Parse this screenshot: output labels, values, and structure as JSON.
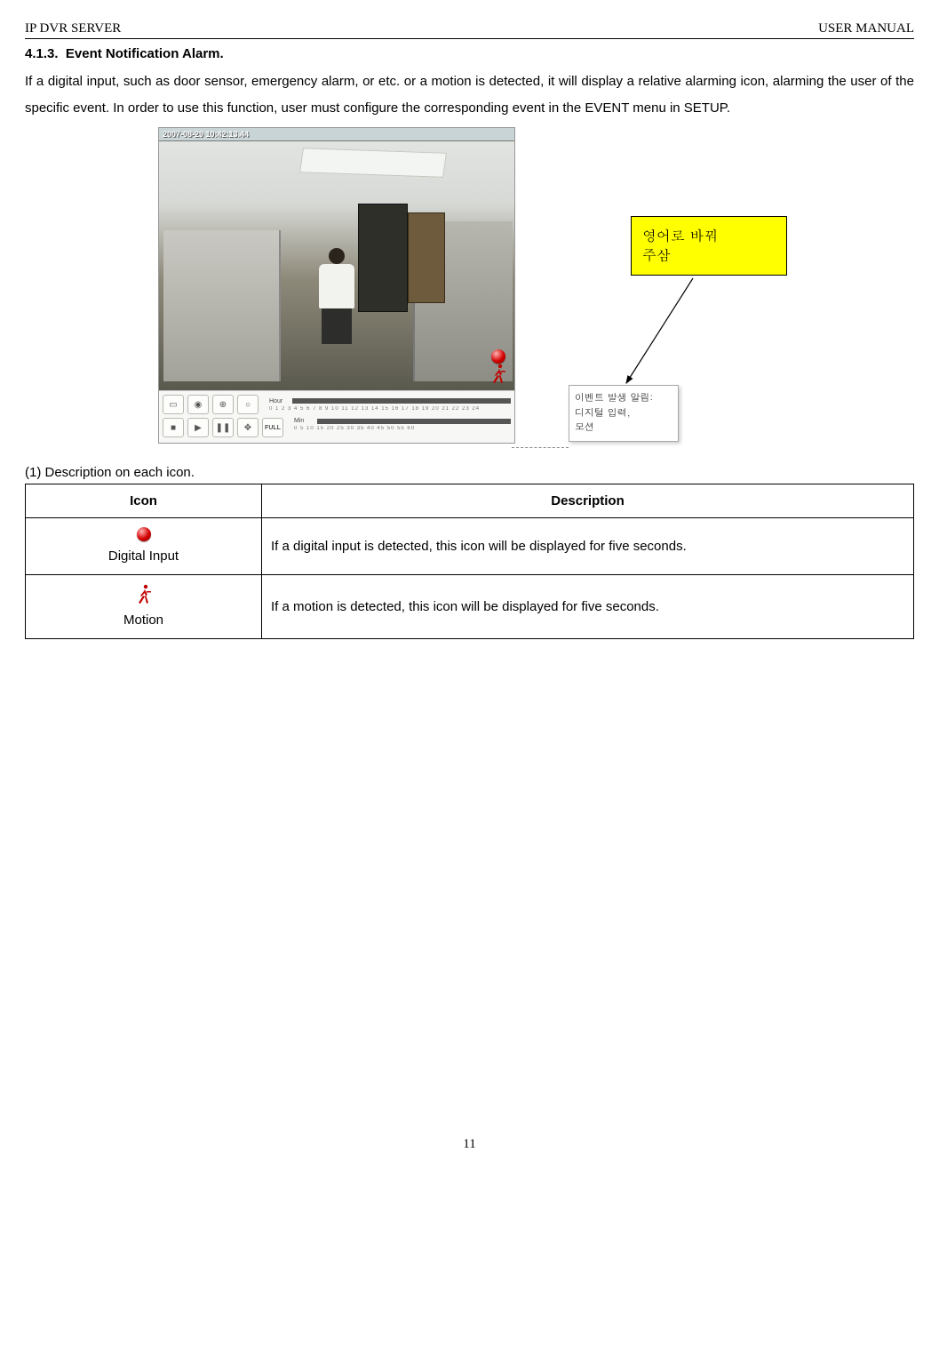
{
  "header": {
    "left": "IP DVR SERVER",
    "right": "USER MANUAL"
  },
  "section": {
    "number": "4.1.3.",
    "title": "Event Notification Alarm."
  },
  "paragraph": "If a digital input, such as door sensor, emergency alarm, or etc. or a motion is detected, it will display a relative alarming icon, alarming the user of the specific event. In order to use this function, user must configure the corresponding event in the EVENT menu in SETUP.",
  "screenshot": {
    "timestamp": "2007-08-29 10:42:13.44",
    "hour_label": "Hour",
    "min_label": "Min",
    "hour_ticks": "0 1 2 3 4 5 6 7 8 9 10 11 12 13 14 15 16 17 18 19 20 21 22 23 24",
    "min_ticks": "0 5 10 15 20 25 30 35 40 45 50 55 60",
    "full_label": "FULL",
    "alarm_red": "●",
    "alarm_run": "run"
  },
  "sticky": {
    "line1": "영어로  바꿔",
    "line2": "주삼"
  },
  "tooltip": {
    "line1": "이벤트 발생 알림:",
    "line2": "디지털 입력,",
    "line3": "모션"
  },
  "subheading": "(1)  Description on each icon.",
  "table": {
    "head_icon": "Icon",
    "head_desc": "Description",
    "rows": [
      {
        "icon_label": "Digital Input",
        "desc": "If a digital input is detected, this icon will be displayed for five seconds."
      },
      {
        "icon_label": "Motion",
        "desc": "If a motion is detected, this icon will be displayed for five seconds."
      }
    ]
  },
  "page_number": "11"
}
